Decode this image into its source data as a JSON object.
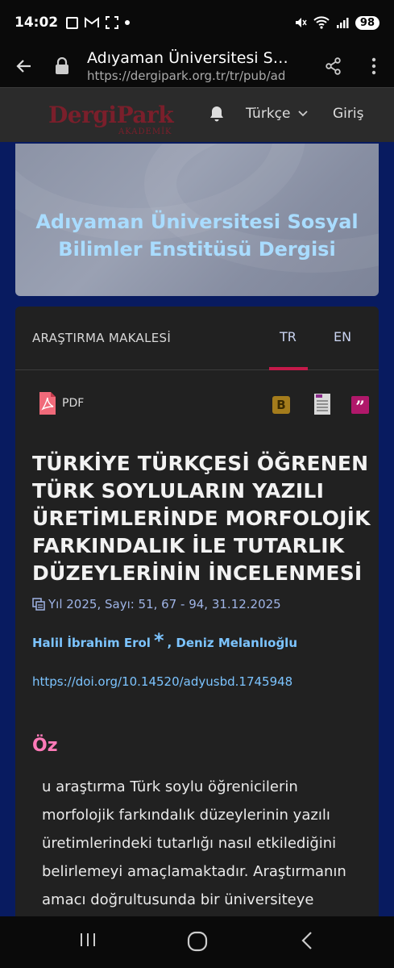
{
  "status": {
    "time": "14:02",
    "battery": "98"
  },
  "browser": {
    "page_title": "Adıyaman Üniversitesi Sosyal Bilimler Enstitüsü Dergisi",
    "url": "https://dergipark.org.tr/tr/pub/ad"
  },
  "site": {
    "logo_main": "DergiPark",
    "logo_sub": "AKADEMİK",
    "language": "Türkçe",
    "login": "Giriş"
  },
  "journal": {
    "title_line1": "Adıyaman Üniversitesi Sosyal",
    "title_line2": "Bilimler Enstitüsü Dergisi"
  },
  "article": {
    "type": "ARAŞTIRMA MAKALESİ",
    "tabs": [
      "TR",
      "EN"
    ],
    "pdf_label": "PDF",
    "cite_b": "B",
    "cite_q": "”",
    "title": "TÜRKİYE TÜRKÇESİ ÖĞRENEN TÜRK SOYLULARIN YAZILI ÜRETİMLERİNDE MORFOLOJİK FARKINDALIK İLE TUTARLIK DÜZEYLERİNİN İNCELENMESİ",
    "meta": "Yıl 2025, Sayı: 51, 67 - 94, 31.12.2025",
    "author1": "Halil İbrahim Erol",
    "author_star": "*",
    "author2": ", Deniz Melanlıoğlu",
    "doi": "https://doi.org/10.14520/adyusbd.1745948",
    "abstract_heading": "Öz",
    "abstract": "u araştırma Türk soylu öğrenicilerin morfolojik farkındalık düzeylerinin yazılı üretimlerindeki tutarlığı nasıl etkilediğini belirlemeyi amaçlamaktadır. Araştırmanın amacı doğrultusunda bir üniversiteye"
  },
  "colors": {
    "accent": "#c41a4a",
    "link": "#7cc4ff",
    "heading_pink": "#ff7ab8",
    "page_bg": "#081b60",
    "card_bg": "#212121"
  }
}
